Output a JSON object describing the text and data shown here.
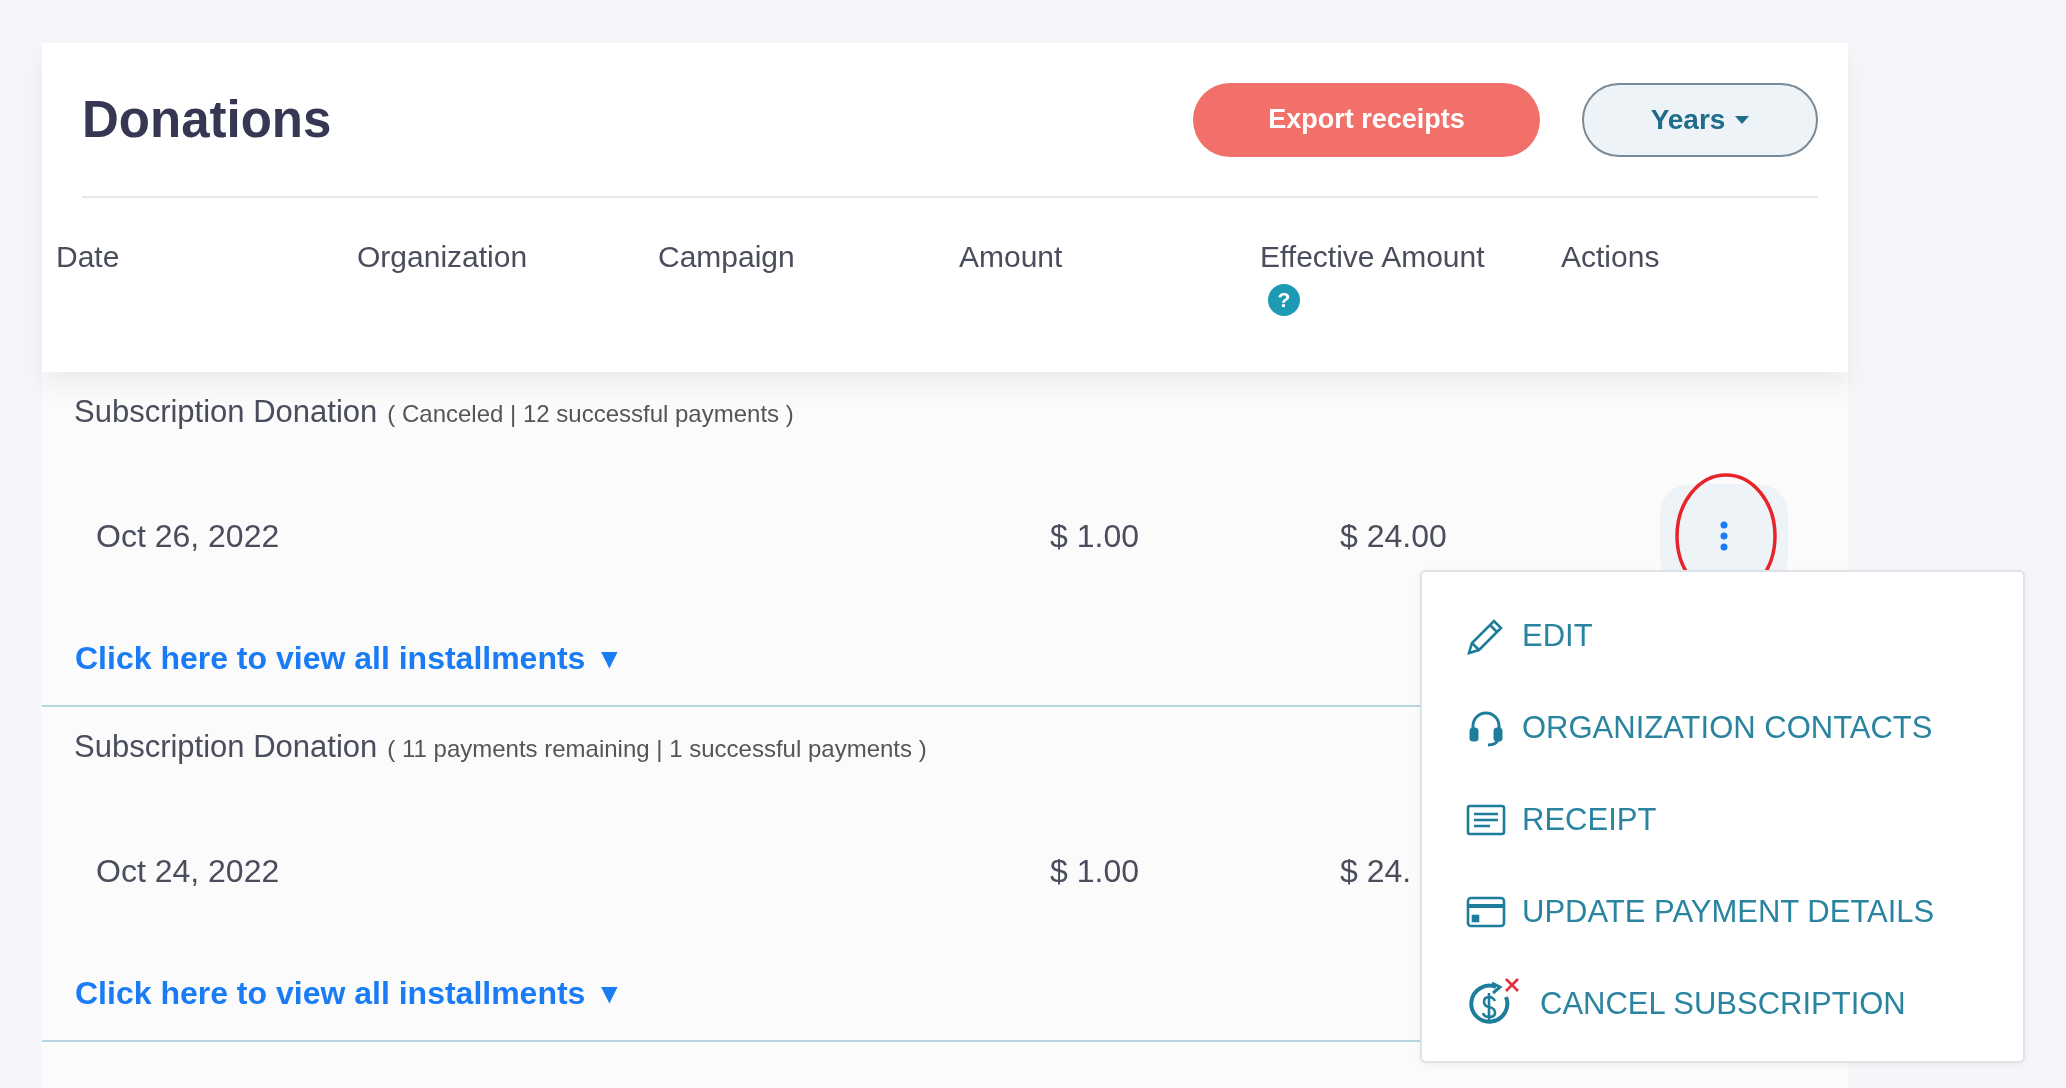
{
  "page": {
    "title": "Donations"
  },
  "toolbar": {
    "export_button": "Export receipts",
    "years_dropdown": "Years"
  },
  "table": {
    "columns": [
      {
        "label": "Date"
      },
      {
        "label": "Organization"
      },
      {
        "label": "Campaign"
      },
      {
        "label": "Amount"
      },
      {
        "label": "Effective Amount",
        "help_icon": "?"
      },
      {
        "label": "Actions"
      }
    ],
    "groups": [
      {
        "title": "Subscription Donation",
        "details": "( Canceled | 12 successful payments )",
        "date": "Oct 26, 2022",
        "amount": "$ 1.00",
        "effective_amount": "$ 24.00",
        "link": "Click here to view all installments",
        "link_arrow": "▼"
      },
      {
        "title": "Subscription Donation",
        "details": "( 11 payments remaining | 1 successful payments )",
        "date": "Oct 24, 2022",
        "amount": "$ 1.00",
        "effective_amount": "$ 24.",
        "link": "Click here to view all installments",
        "link_arrow": "▼"
      }
    ]
  },
  "actions_menu": {
    "items": [
      {
        "kind": "edit",
        "label": "EDIT"
      },
      {
        "kind": "contacts",
        "label": "ORGANIZATION CONTACTS"
      },
      {
        "kind": "receipt",
        "label": "RECEIPT"
      },
      {
        "kind": "payment",
        "label": "UPDATE PAYMENT DETAILS"
      },
      {
        "kind": "cancel",
        "label": "CANCEL SUBSCRIPTION"
      }
    ]
  }
}
